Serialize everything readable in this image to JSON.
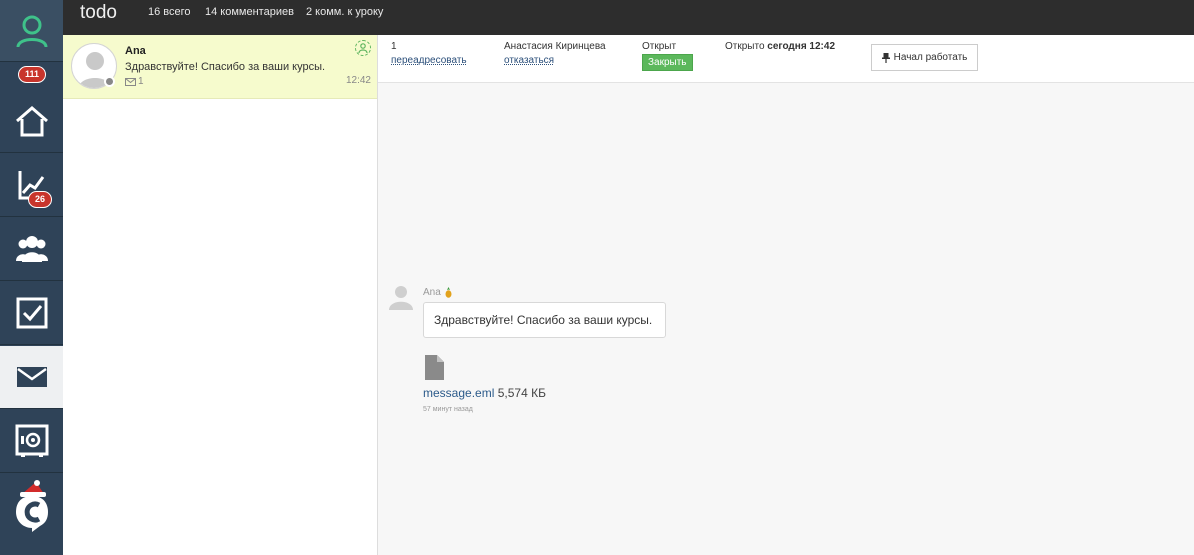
{
  "topbar": {
    "title": "todo",
    "stats": [
      "16 всего",
      "14 комментариев",
      "2 комм. к уроку"
    ]
  },
  "sidebar": {
    "items": [
      {
        "icon": "user-icon",
        "badge": "111"
      },
      {
        "icon": "home-icon"
      },
      {
        "icon": "chart-icon",
        "badge": "26"
      },
      {
        "icon": "users-icon"
      },
      {
        "icon": "checkbox-icon"
      },
      {
        "icon": "mail-icon",
        "active": true
      },
      {
        "icon": "safe-icon"
      },
      {
        "icon": "brand-icon"
      }
    ]
  },
  "conversation": {
    "name": "Ana",
    "preview": "Здравствуйте! Спасибо за ваши курсы.",
    "count": "1",
    "time": "12:42"
  },
  "header": {
    "number": "1",
    "forward_link": "переадресовать",
    "assignee": "Анастасия Киринцева",
    "refuse_link": "отказаться",
    "status": "Открыт",
    "close_button": "Закрыть",
    "opened_label": "Открыто",
    "opened_time": "сегодня 12:42",
    "start_button": "Начал работать"
  },
  "message": {
    "author": "Ana",
    "text": "Здравствуйте! Спасибо за ваши курсы.",
    "file_name": "message.eml",
    "file_size": "5,574 КБ",
    "time_ago": "57 минут назад"
  },
  "colors": {
    "sidebar": "#2f4358",
    "topbar": "#2d2d2d",
    "badge": "#c8352c",
    "accent_green": "#5cb85c",
    "selected_row": "#f6fbcd"
  }
}
